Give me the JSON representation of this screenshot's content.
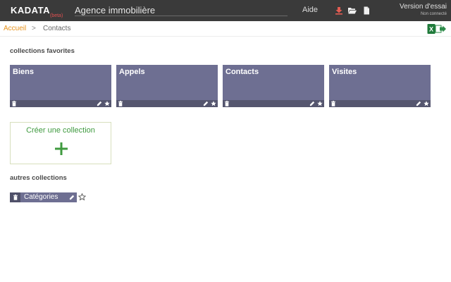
{
  "app": {
    "logo": "KADATA",
    "beta": "(beta)",
    "title": "Agence immobilière"
  },
  "topbar": {
    "help": "Aide",
    "version": "Version d'essai",
    "connection": "Non connecté"
  },
  "breadcrumb": {
    "home": "Accueil",
    "separator": ">",
    "current": "Contacts"
  },
  "favorites": {
    "title": "collections favorites",
    "cards": [
      {
        "name": "Biens"
      },
      {
        "name": "Appels"
      },
      {
        "name": "Contacts"
      },
      {
        "name": "Visites"
      }
    ]
  },
  "create": {
    "label": "Créer une collection"
  },
  "others": {
    "title": "autres collections",
    "items": [
      {
        "name": "Catégories"
      }
    ]
  },
  "colors": {
    "topbar": "#3a3a3a",
    "card": "#6e6f92",
    "accent": "#e8921a",
    "create_green": "#3f9a3f"
  }
}
